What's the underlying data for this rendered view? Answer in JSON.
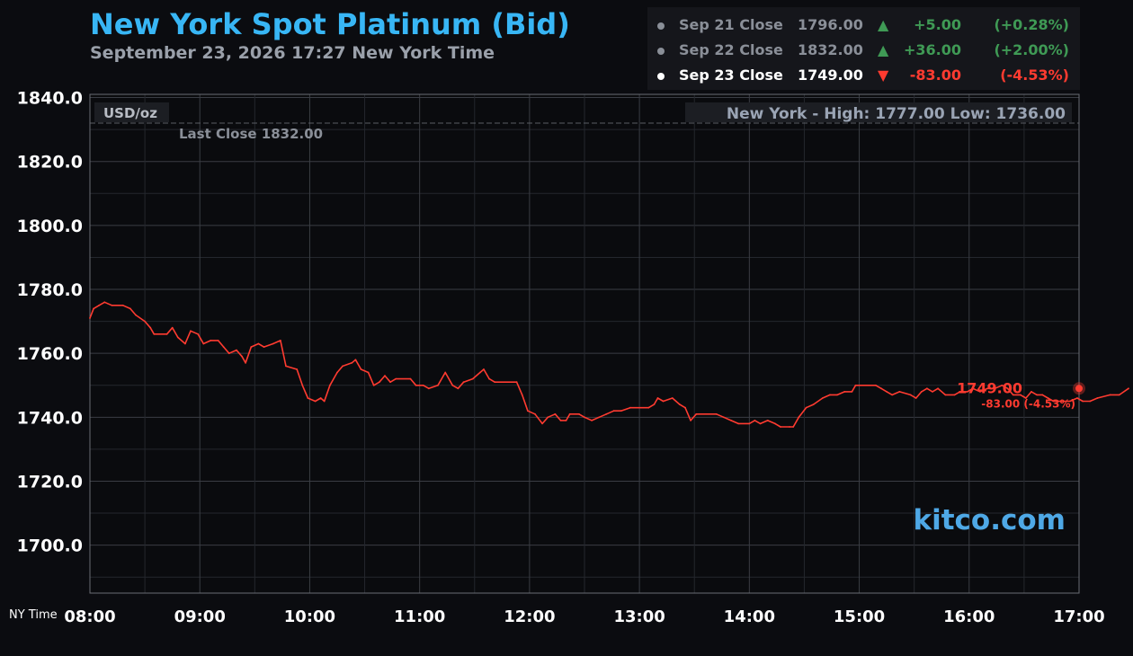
{
  "header": {
    "title": "New York Spot Platinum (Bid)",
    "subtitle": "September 23, 2026 17:27 New York Time"
  },
  "closes": [
    {
      "date": "Sep 21 Close",
      "price": "1796.00",
      "arrow": "▲",
      "change": "+5.00",
      "pct": "(+0.28%)",
      "state": "up-old"
    },
    {
      "date": "Sep 22 Close",
      "price": "1832.00",
      "arrow": "▲",
      "change": "+36.00",
      "pct": "(+2.00%)",
      "state": "up-old"
    },
    {
      "date": "Sep 23 Close",
      "price": "1749.00",
      "arrow": "▼",
      "change": "-83.00",
      "pct": "(-4.53%)",
      "state": "down-current"
    }
  ],
  "colors": {
    "title": "#38b6f5",
    "line": "#ff3b30",
    "up": "#3f9a55",
    "down": "#ff3b30",
    "grid": "#2a2d33",
    "watermark": "#4ea8e6"
  },
  "chart_data": {
    "type": "line",
    "unit_label": "USD/oz",
    "last_close_label": "Last Close 1832.00",
    "last_close": 1832,
    "high_low_label": "New York - High: 1777.00   Low: 1736.00",
    "watermark": "kitco.com",
    "current_price_label": "1749.00",
    "current_change_label": "-83.00 (-4.53%)",
    "x_axis_label": "NY Time",
    "x_ticks": [
      "08:00",
      "09:00",
      "10:00",
      "11:00",
      "12:00",
      "13:00",
      "14:00",
      "15:00",
      "16:00",
      "17:00"
    ],
    "y_ticks": [
      "1840.0",
      "1820.0",
      "1800.0",
      "1780.0",
      "1760.0",
      "1740.0",
      "1720.0",
      "1700.0"
    ],
    "ylim": [
      1685,
      1841
    ],
    "xlim": [
      "08:00",
      "17:00"
    ],
    "grid": true,
    "series": [
      {
        "values": [
          [
            "08:00",
            1771
          ],
          [
            "08:02",
            1774
          ],
          [
            "08:05",
            1775
          ],
          [
            "08:08",
            1776
          ],
          [
            "08:12",
            1775
          ],
          [
            "08:18",
            1775
          ],
          [
            "08:22",
            1774
          ],
          [
            "08:25",
            1772
          ],
          [
            "08:30",
            1770
          ],
          [
            "08:33",
            1768
          ],
          [
            "08:35",
            1766
          ],
          [
            "08:42",
            1766
          ],
          [
            "08:45",
            1768
          ],
          [
            "08:48",
            1765
          ],
          [
            "08:52",
            1763
          ],
          [
            "08:55",
            1767
          ],
          [
            "08:59",
            1766
          ],
          [
            "09:02",
            1763
          ],
          [
            "09:06",
            1764
          ],
          [
            "09:10",
            1764
          ],
          [
            "09:13",
            1762
          ],
          [
            "09:16",
            1760
          ],
          [
            "09:20",
            1761
          ],
          [
            "09:23",
            1759
          ],
          [
            "09:25",
            1757
          ],
          [
            "09:28",
            1762
          ],
          [
            "09:32",
            1763
          ],
          [
            "09:35",
            1762
          ],
          [
            "09:40",
            1763
          ],
          [
            "09:44",
            1764
          ],
          [
            "09:47",
            1756
          ],
          [
            "09:53",
            1755
          ],
          [
            "09:56",
            1750
          ],
          [
            "09:59",
            1746
          ],
          [
            "10:03",
            1745
          ],
          [
            "10:06",
            1746
          ],
          [
            "10:08",
            1745
          ],
          [
            "10:11",
            1750
          ],
          [
            "10:15",
            1754
          ],
          [
            "10:18",
            1756
          ],
          [
            "10:23",
            1757
          ],
          [
            "10:25",
            1758
          ],
          [
            "10:28",
            1755
          ],
          [
            "10:32",
            1754
          ],
          [
            "10:35",
            1750
          ],
          [
            "10:38",
            1751
          ],
          [
            "10:41",
            1753
          ],
          [
            "10:44",
            1751
          ],
          [
            "10:47",
            1752
          ],
          [
            "10:55",
            1752
          ],
          [
            "10:58",
            1750
          ],
          [
            "11:02",
            1750
          ],
          [
            "11:05",
            1749
          ],
          [
            "11:10",
            1750
          ],
          [
            "11:14",
            1754
          ],
          [
            "11:18",
            1750
          ],
          [
            "11:21",
            1749
          ],
          [
            "11:24",
            1751
          ],
          [
            "11:29",
            1752
          ],
          [
            "11:33",
            1754
          ],
          [
            "11:35",
            1755
          ],
          [
            "11:38",
            1752
          ],
          [
            "11:41",
            1751
          ],
          [
            "11:53",
            1751
          ],
          [
            "11:56",
            1747
          ],
          [
            "11:59",
            1742
          ],
          [
            "12:03",
            1741
          ],
          [
            "12:07",
            1738
          ],
          [
            "12:10",
            1740
          ],
          [
            "12:14",
            1741
          ],
          [
            "12:17",
            1739
          ],
          [
            "12:20",
            1739
          ],
          [
            "12:22",
            1741
          ],
          [
            "12:27",
            1741
          ],
          [
            "12:30",
            1740
          ],
          [
            "12:34",
            1739
          ],
          [
            "12:38",
            1740
          ],
          [
            "12:42",
            1741
          ],
          [
            "12:46",
            1742
          ],
          [
            "12:50",
            1742
          ],
          [
            "12:55",
            1743
          ],
          [
            "13:05",
            1743
          ],
          [
            "13:08",
            1744
          ],
          [
            "13:10",
            1746
          ],
          [
            "13:13",
            1745
          ],
          [
            "13:18",
            1746
          ],
          [
            "13:22",
            1744
          ],
          [
            "13:25",
            1743
          ],
          [
            "13:28",
            1739
          ],
          [
            "13:31",
            1741
          ],
          [
            "13:42",
            1741
          ],
          [
            "13:46",
            1740
          ],
          [
            "13:50",
            1739
          ],
          [
            "13:54",
            1738
          ],
          [
            "14:00",
            1738
          ],
          [
            "14:03",
            1739
          ],
          [
            "14:06",
            1738
          ],
          [
            "14:10",
            1739
          ],
          [
            "14:14",
            1738
          ],
          [
            "14:17",
            1737
          ],
          [
            "14:22",
            1737
          ],
          [
            "14:24",
            1737
          ],
          [
            "14:27",
            1740
          ],
          [
            "14:31",
            1743
          ],
          [
            "14:35",
            1744
          ],
          [
            "14:40",
            1746
          ],
          [
            "14:44",
            1747
          ],
          [
            "14:48",
            1747
          ],
          [
            "14:52",
            1748
          ],
          [
            "14:56",
            1748
          ],
          [
            "14:58",
            1750
          ],
          [
            "15:09",
            1750
          ],
          [
            "15:12",
            1749
          ],
          [
            "15:15",
            1748
          ],
          [
            "15:18",
            1747
          ],
          [
            "15:22",
            1748
          ],
          [
            "15:28",
            1747
          ],
          [
            "15:31",
            1746
          ],
          [
            "15:34",
            1748
          ],
          [
            "15:37",
            1749
          ],
          [
            "15:40",
            1748
          ],
          [
            "15:43",
            1749
          ],
          [
            "15:47",
            1747
          ],
          [
            "15:52",
            1747
          ],
          [
            "15:55",
            1748
          ],
          [
            "15:59",
            1748
          ],
          [
            "16:02",
            1749
          ],
          [
            "16:06",
            1748
          ],
          [
            "16:10",
            1749
          ],
          [
            "16:14",
            1749
          ],
          [
            "16:18",
            1750
          ],
          [
            "16:21",
            1749
          ],
          [
            "16:24",
            1747
          ],
          [
            "16:28",
            1747
          ],
          [
            "16:31",
            1746
          ],
          [
            "16:34",
            1748
          ],
          [
            "16:37",
            1747
          ],
          [
            "16:40",
            1747
          ],
          [
            "16:43",
            1746
          ],
          [
            "16:46",
            1745
          ],
          [
            "16:55",
            1745
          ],
          [
            "16:59",
            1746
          ],
          [
            "17:02",
            1745
          ],
          [
            "17:06",
            1745
          ],
          [
            "17:10",
            1746
          ],
          [
            "17:17",
            1747
          ],
          [
            "17:22",
            1747
          ],
          [
            "17:27",
            1749
          ]
        ]
      }
    ]
  }
}
